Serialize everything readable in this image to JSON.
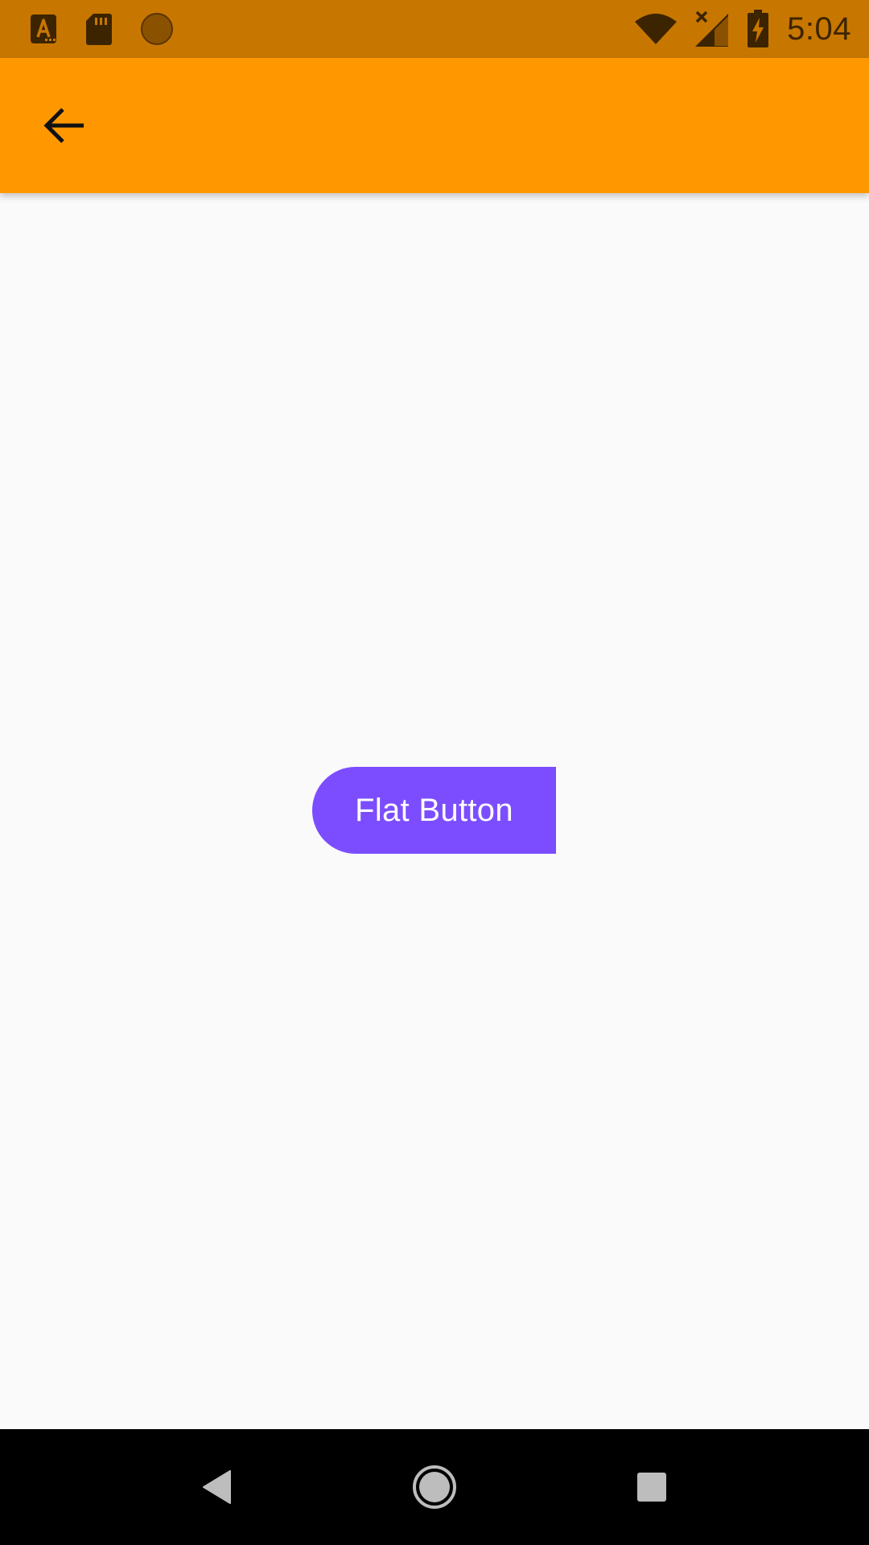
{
  "status_bar": {
    "time": "5:04",
    "left_icons": [
      "app-notification-icon",
      "sd-card-icon",
      "record-icon"
    ],
    "right_icons": [
      "wifi-icon",
      "cellular-no-signal-icon",
      "battery-charging-icon"
    ]
  },
  "app_bar": {
    "back_icon": "arrow-back-icon",
    "color": "#ff9800"
  },
  "main": {
    "flat_button_label": "Flat Button",
    "flat_button_color": "#7c4dff"
  },
  "nav_bar": {
    "buttons": [
      "back-triangle-icon",
      "home-circle-icon",
      "recents-square-icon"
    ]
  }
}
